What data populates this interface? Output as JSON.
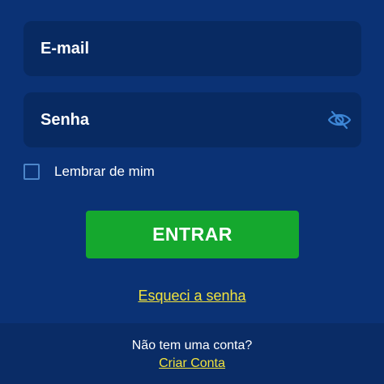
{
  "login_form": {
    "email_placeholder": "E-mail",
    "password_placeholder": "Senha",
    "toggle_password_icon": "eye-slash-icon",
    "remember_label": "Lembrar de mim",
    "remember_checked": false,
    "submit_label": "ENTRAR",
    "forgot_label": "Esqueci a senha"
  },
  "footer": {
    "prompt": "Não tem uma conta?",
    "signup_label": "Criar Conta"
  },
  "colors": {
    "background": "#0b3275",
    "field_background": "#082a62",
    "button": "#15a82e",
    "link": "#f2e33d",
    "icon": "#3d86d6"
  }
}
